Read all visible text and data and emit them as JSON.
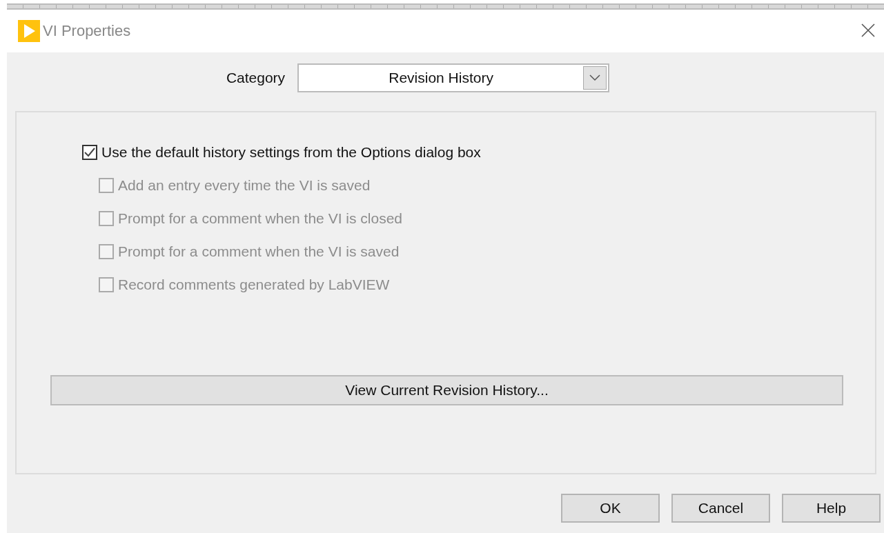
{
  "window": {
    "title": "VI Properties"
  },
  "category": {
    "label": "Category",
    "value": "Revision History"
  },
  "options": [
    {
      "label": "Use the default history settings from the Options dialog box",
      "checked": true,
      "disabled": false,
      "kind": "main"
    },
    {
      "label": "Add an entry every time the VI is saved",
      "checked": false,
      "disabled": true,
      "kind": "sub"
    },
    {
      "label": "Prompt for a comment when the VI is closed",
      "checked": false,
      "disabled": true,
      "kind": "sub"
    },
    {
      "label": "Prompt for a comment when the VI is saved",
      "checked": false,
      "disabled": true,
      "kind": "sub"
    },
    {
      "label": "Record comments generated by LabVIEW",
      "checked": false,
      "disabled": true,
      "kind": "sub"
    }
  ],
  "view_button": "View Current Revision History...",
  "buttons": [
    "OK",
    "Cancel",
    "Help"
  ]
}
